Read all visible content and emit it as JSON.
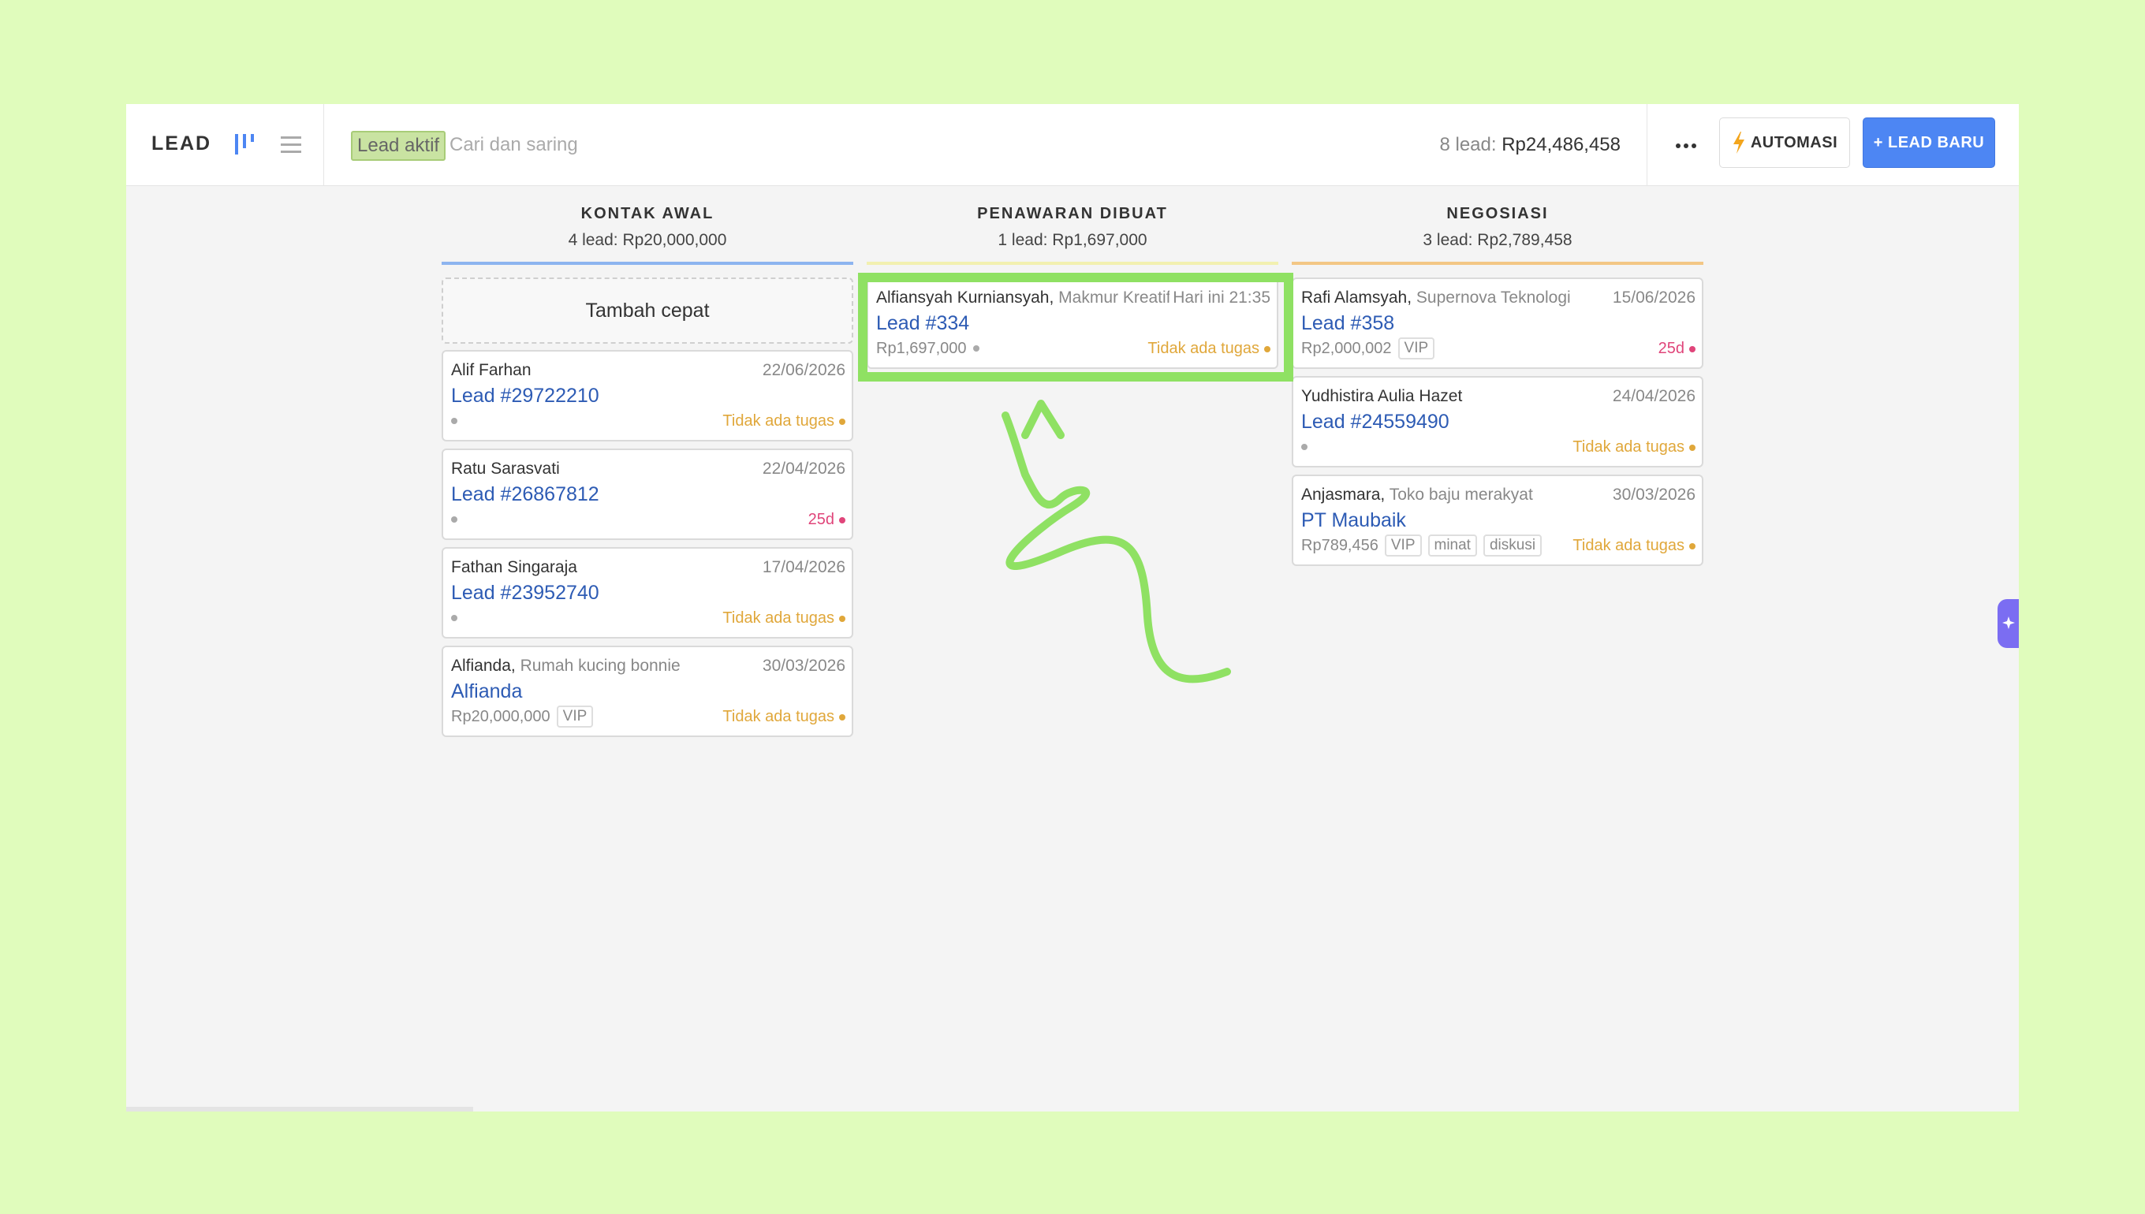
{
  "header": {
    "title": "LEAD",
    "filter_chip": "Lead aktif",
    "search_placeholder": "Cari dan saring",
    "summary_count": "8 lead:",
    "summary_amount": "Rp24,486,458",
    "automation_label": "AUTOMASI",
    "new_lead_label": "+ LEAD BARU"
  },
  "quick_add_label": "Tambah cepat",
  "colors": {
    "kontak_awal": "#8db4ef",
    "penawaran_dibuat": "#f2f0b0",
    "negosiasi": "#f3c785",
    "link": "#2d5bb4",
    "no_task": "#e0a73a",
    "overdue": "#e0457a",
    "primary_button": "#4d86f3",
    "highlight": "#8fe163"
  },
  "columns": [
    {
      "name": "KONTAK AWAL",
      "summary": "4 lead: Rp20,000,000",
      "cards": [
        {
          "contact": "Alif Farhan",
          "company": "",
          "date": "22/06/2026",
          "title": "Lead #29722210",
          "amount": "",
          "tags": [],
          "status": "Tidak ada tugas",
          "status_type": "no_task"
        },
        {
          "contact": "Ratu Sarasvati",
          "company": "",
          "date": "22/04/2026",
          "title": "Lead #26867812",
          "amount": "",
          "tags": [],
          "status": "25d",
          "status_type": "overdue"
        },
        {
          "contact": "Fathan Singaraja",
          "company": "",
          "date": "17/04/2026",
          "title": "Lead #23952740",
          "amount": "",
          "tags": [],
          "status": "Tidak ada tugas",
          "status_type": "no_task"
        },
        {
          "contact": "Alfianda,",
          "company": "Rumah kucing bonnie",
          "date": "30/03/2026",
          "title": "Alfianda",
          "amount": "Rp20,000,000",
          "tags": [
            "VIP"
          ],
          "status": "Tidak ada tugas",
          "status_type": "no_task"
        }
      ]
    },
    {
      "name": "PENAWARAN DIBUAT",
      "summary": "1 lead: Rp1,697,000",
      "cards": [
        {
          "contact": "Alfiansyah Kurniansyah,",
          "company": "Makmur Kreatif",
          "date": "Hari ini 21:35",
          "title": "Lead #334",
          "amount": "Rp1,697,000",
          "tags": [],
          "status": "Tidak ada tugas",
          "status_type": "no_task"
        }
      ]
    },
    {
      "name": "NEGOSIASI",
      "summary": "3 lead: Rp2,789,458",
      "cards": [
        {
          "contact": "Rafi Alamsyah,",
          "company": "Supernova Teknologi",
          "date": "15/06/2026",
          "title": "Lead #358",
          "amount": "Rp2,000,002",
          "tags": [
            "VIP"
          ],
          "status": "25d",
          "status_type": "overdue"
        },
        {
          "contact": "Yudhistira Aulia Hazet",
          "company": "",
          "date": "24/04/2026",
          "title": "Lead #24559490",
          "amount": "",
          "tags": [],
          "status": "Tidak ada tugas",
          "status_type": "no_task"
        },
        {
          "contact": "Anjasmara,",
          "company": "Toko baju merakyat",
          "date": "30/03/2026",
          "title": "PT Maubaik",
          "amount": "Rp789,456",
          "tags": [
            "VIP",
            "minat",
            "diskusi"
          ],
          "status": "Tidak ada tugas",
          "status_type": "no_task"
        }
      ]
    }
  ]
}
